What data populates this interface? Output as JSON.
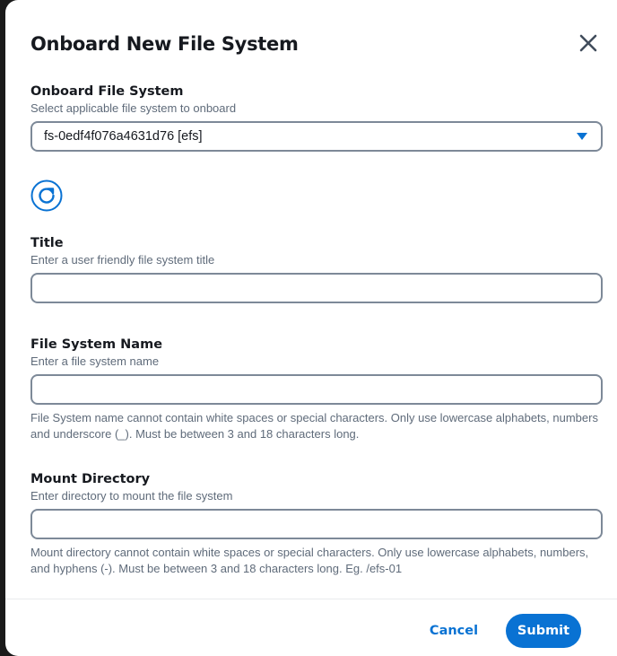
{
  "modal": {
    "title": "Onboard New File System",
    "close_icon": "close-icon"
  },
  "file_system_select": {
    "label": "Onboard File System",
    "description": "Select applicable file system to onboard",
    "selected_value": "fs-0edf4f076a4631d76 [efs]",
    "dropdown_icon": "caret-down-icon",
    "refresh_icon": "refresh-icon"
  },
  "title_field": {
    "label": "Title",
    "description": "Enter a user friendly file system title",
    "value": ""
  },
  "file_system_name_field": {
    "label": "File System Name",
    "description": "Enter a file system name",
    "value": "",
    "constraint": "File System name cannot contain white spaces or special characters. Only use lowercase alphabets, numbers and underscore (_). Must be between 3 and 18 characters long."
  },
  "mount_directory_field": {
    "label": "Mount Directory",
    "description": "Enter directory to mount the file system",
    "value": "",
    "constraint": "Mount directory cannot contain white spaces or special characters. Only use lowercase alphabets, numbers, and hyphens (-). Must be between 3 and 18 characters long. Eg. /efs-01"
  },
  "footer": {
    "cancel_label": "Cancel",
    "submit_label": "Submit"
  },
  "colors": {
    "accent": "#0972d3",
    "text": "#16191f",
    "muted_text": "#5f6b7a",
    "border": "#7d8998",
    "backdrop": "#1a1a1a"
  }
}
